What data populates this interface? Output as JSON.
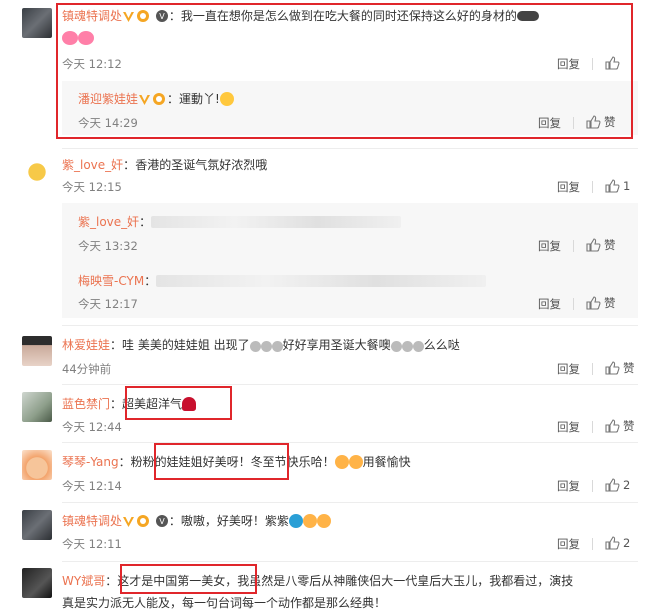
{
  "comments": [
    {
      "username": "镇魂特调处",
      "text": "我一直在想你是怎么做到在吃大餐的同时还保持这么好的身材的",
      "time": "今天 12:12",
      "reply": "回复",
      "likes": "",
      "reply_thread": [
        {
          "username": "潘迎紫娃娃",
          "text": "運動丫!",
          "time": "今天 14:29",
          "reply": "回复",
          "likes": "赞"
        }
      ]
    },
    {
      "username": "紫_love_奸",
      "text": "香港的圣诞气氛好浓烈哦",
      "time": "今天 12:15",
      "reply": "回复",
      "likes": "1",
      "reply_thread": [
        {
          "username": "紫_love_奸",
          "time": "今天 13:32",
          "reply": "回复",
          "likes": "赞"
        },
        {
          "username": "梅映雪-CYM",
          "time": "今天 12:17",
          "reply": "回复",
          "likes": "赞"
        }
      ]
    },
    {
      "username": "林爱娃娃",
      "text": "哇 美美的娃娃姐 出现了",
      "text2": "好好享用圣诞大餐噢",
      "text3": "么么哒",
      "time": "44分钟前",
      "reply": "回复",
      "likes": "赞"
    },
    {
      "username": "蓝色禁门",
      "text": "超美超洋气",
      "time": "今天 12:44",
      "reply": "回复",
      "likes": "赞"
    },
    {
      "username": "琴琴-Yang",
      "text": "粉粉的娃娃姐好美呀！",
      "text2": "冬至节快乐哈！",
      "text3": "用餐愉快",
      "time": "今天 12:14",
      "reply": "回复",
      "likes": "2"
    },
    {
      "username": "镇魂特调处",
      "text": "嗷嗷，好美呀！紫紫",
      "time": "今天 12:11",
      "reply": "回复",
      "likes": "2"
    },
    {
      "username": "WY斌哥",
      "text": "这才是中国第一美女",
      "text2": "，我虽然是八零后从神雕侠侣大一代皇后大玉儿，我都看过，演技",
      "text3": "真是实力派无人能及，每一句台词每一个动作都是那么经典！"
    }
  ],
  "colors": {
    "username": "#eb7350",
    "highlight_box": "#e0262b",
    "time": "#808080"
  },
  "icons": [
    "thumbs-up-icon",
    "verified-v-icon",
    "vip-icon",
    "member-badge-icon"
  ]
}
